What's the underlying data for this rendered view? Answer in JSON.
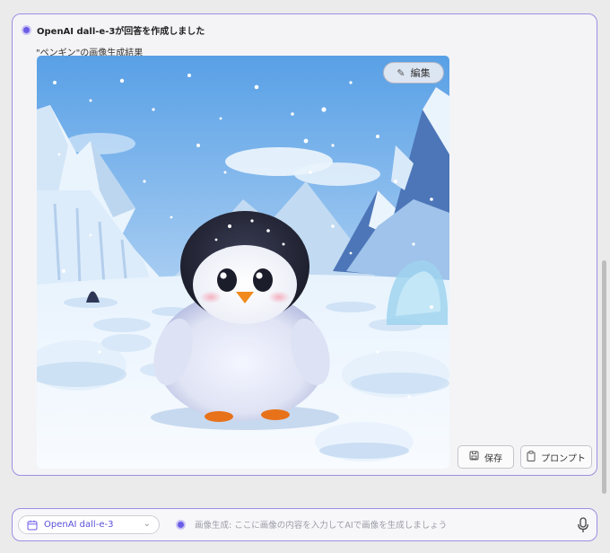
{
  "response": {
    "header_title": "OpenAI dall-e-3が回答を作成しました",
    "caption": "\"ペンギン\"の画像生成結果",
    "image": {
      "subject": "cute fluffy baby penguin sitting on snow in front of icy mountains, falling snow"
    },
    "edit_label": "編集",
    "save_label": "保存",
    "prompt_label": "プロンプト"
  },
  "composer": {
    "model": "OpenAI dall-e-3",
    "placeholder": "画像生成: ここに画像の内容を入力してAIで画像を生成しましょう"
  },
  "colors": {
    "accent": "#6b5ce7",
    "border": "#9b8fe3",
    "sky_top": "#5aa3e8",
    "sky_bottom": "#cfe4f7"
  },
  "icons": {
    "header": "status-dot-icon",
    "edit": "pencil-icon",
    "save": "save-icon",
    "prompt": "clipboard-icon",
    "model": "calendar-icon",
    "dropdown": "chevron-down-icon",
    "mic": "microphone-icon"
  }
}
